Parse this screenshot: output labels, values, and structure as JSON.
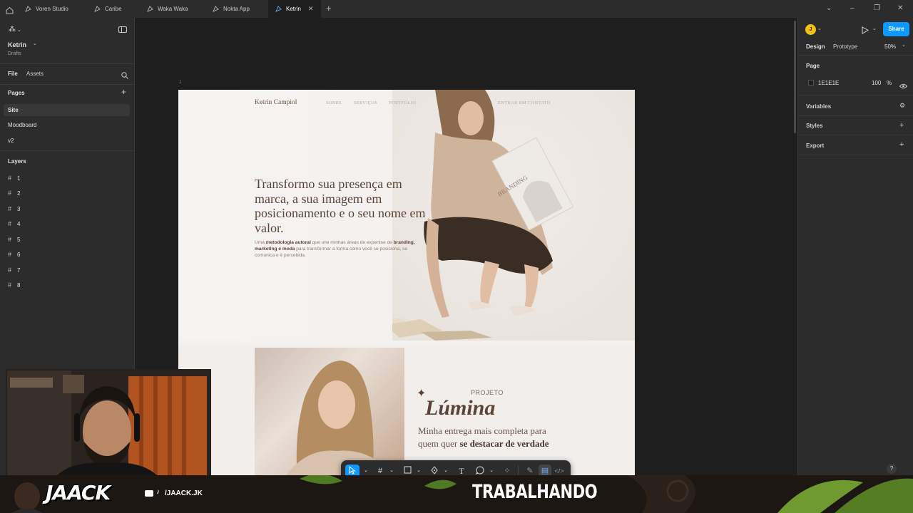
{
  "tabs": [
    {
      "label": "Voren Studio",
      "active": false
    },
    {
      "label": "Caribe",
      "active": false
    },
    {
      "label": "Waka Waka",
      "active": false
    },
    {
      "label": "Nokta App",
      "active": false
    },
    {
      "label": "Ketrin",
      "active": true
    }
  ],
  "left_panel": {
    "file_name": "Ketrin",
    "file_location": "Drafts",
    "tab_file": "File",
    "tab_assets": "Assets",
    "pages_heading": "Pages",
    "pages": [
      "Site",
      "Moodboard",
      "v2"
    ],
    "layers_heading": "Layers",
    "layers": [
      "1",
      "2",
      "3",
      "4",
      "5",
      "6",
      "7",
      "8"
    ]
  },
  "right_panel": {
    "avatar_initial": "J",
    "share_label": "Share",
    "tab_design": "Design",
    "tab_prototype": "Prototype",
    "zoom": "50%",
    "page_heading": "Page",
    "page_color": "1E1E1E",
    "page_opacity": "100",
    "percent_sign": "%",
    "variables": "Variables",
    "styles": "Styles",
    "export": "Export",
    "help": "?"
  },
  "canvas": {
    "frame_label": "1",
    "site": {
      "logo": "Ketrin Campiol",
      "nav": [
        "SOBRE",
        "SERVIÇOS",
        "PORTFÓLIO"
      ],
      "cta": "ENTRAR EM CONTATO",
      "headline": "Transformo sua presença em marca, a sua imagem em posicionamento e o seu nome em valor.",
      "sub_pre": "Uma ",
      "sub_bold1": "metodologia autoral",
      "sub_mid": " que une minhas áreas de expertise de ",
      "sub_bold2": "branding, marketing e moda",
      "sub_post": " para transformar a forma como você se posiciona, se comunica e é percebida.",
      "magazine_text": "BRANDING",
      "project_label": "PROJETO",
      "project_title": "Lúmina",
      "project_copy_1": "Minha entrega mais completa para quem quer ",
      "project_copy_bold": "se destacar de verdade"
    }
  },
  "overlay": {
    "brand": "JAACK",
    "social": "/JAACK.JK",
    "status": "TRABALHANDO"
  },
  "colors": {
    "accent": "#0d99ff",
    "avatar": "#f2c21b",
    "panel": "#2c2c2c",
    "canvas": "#1e1e1e",
    "site_text": "#5b4337"
  }
}
